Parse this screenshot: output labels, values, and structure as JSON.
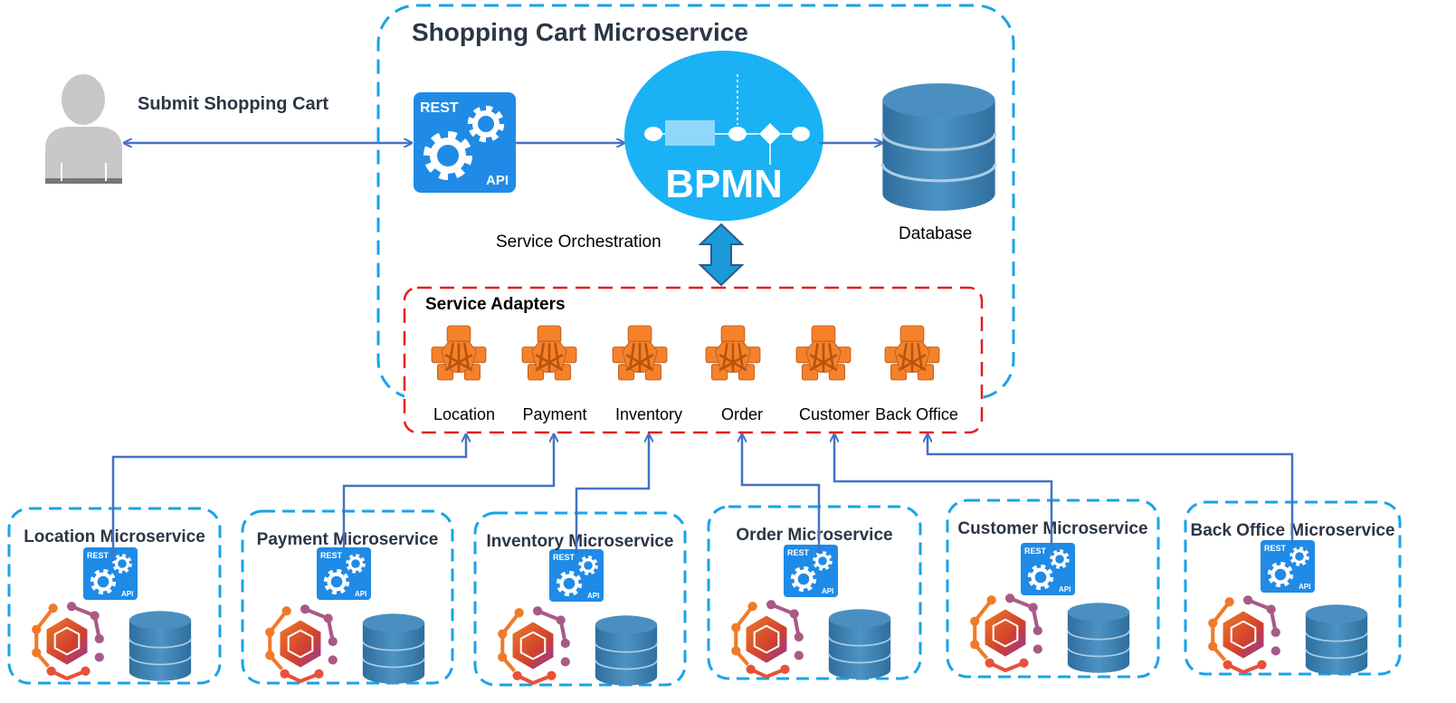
{
  "main": {
    "title": "Shopping Cart Microservice",
    "submit_label": "Submit Shopping Cart",
    "bpmn_label": "BPMN",
    "database_label": "Database",
    "orchestration_label": "Service Orchestration",
    "adapters_title": "Service Adapters",
    "rest_text": "REST",
    "api_text": "API"
  },
  "adapters": [
    "Location",
    "Payment",
    "Inventory",
    "Order",
    "Customer",
    "Back Office"
  ],
  "microservices": [
    "Location Microservice",
    "Payment Microservice",
    "Inventory Microservice",
    "Order Microservice",
    "Customer Microservice",
    "Back Office Microservice"
  ],
  "icons": [
    "user-icon",
    "rest-api-icon",
    "bpmn-icon",
    "database-icon",
    "service-adapter-icon",
    "microservice-hexagon-icon"
  ],
  "colors": {
    "container_border": "#1aa3e8",
    "adapters_border": "#e81c1c",
    "connector": "#4472c4",
    "bpmn": "#1ab2f5",
    "rest_api": "#1f8be6",
    "adapter": "#f5822a",
    "database": "#3b7fb0"
  }
}
